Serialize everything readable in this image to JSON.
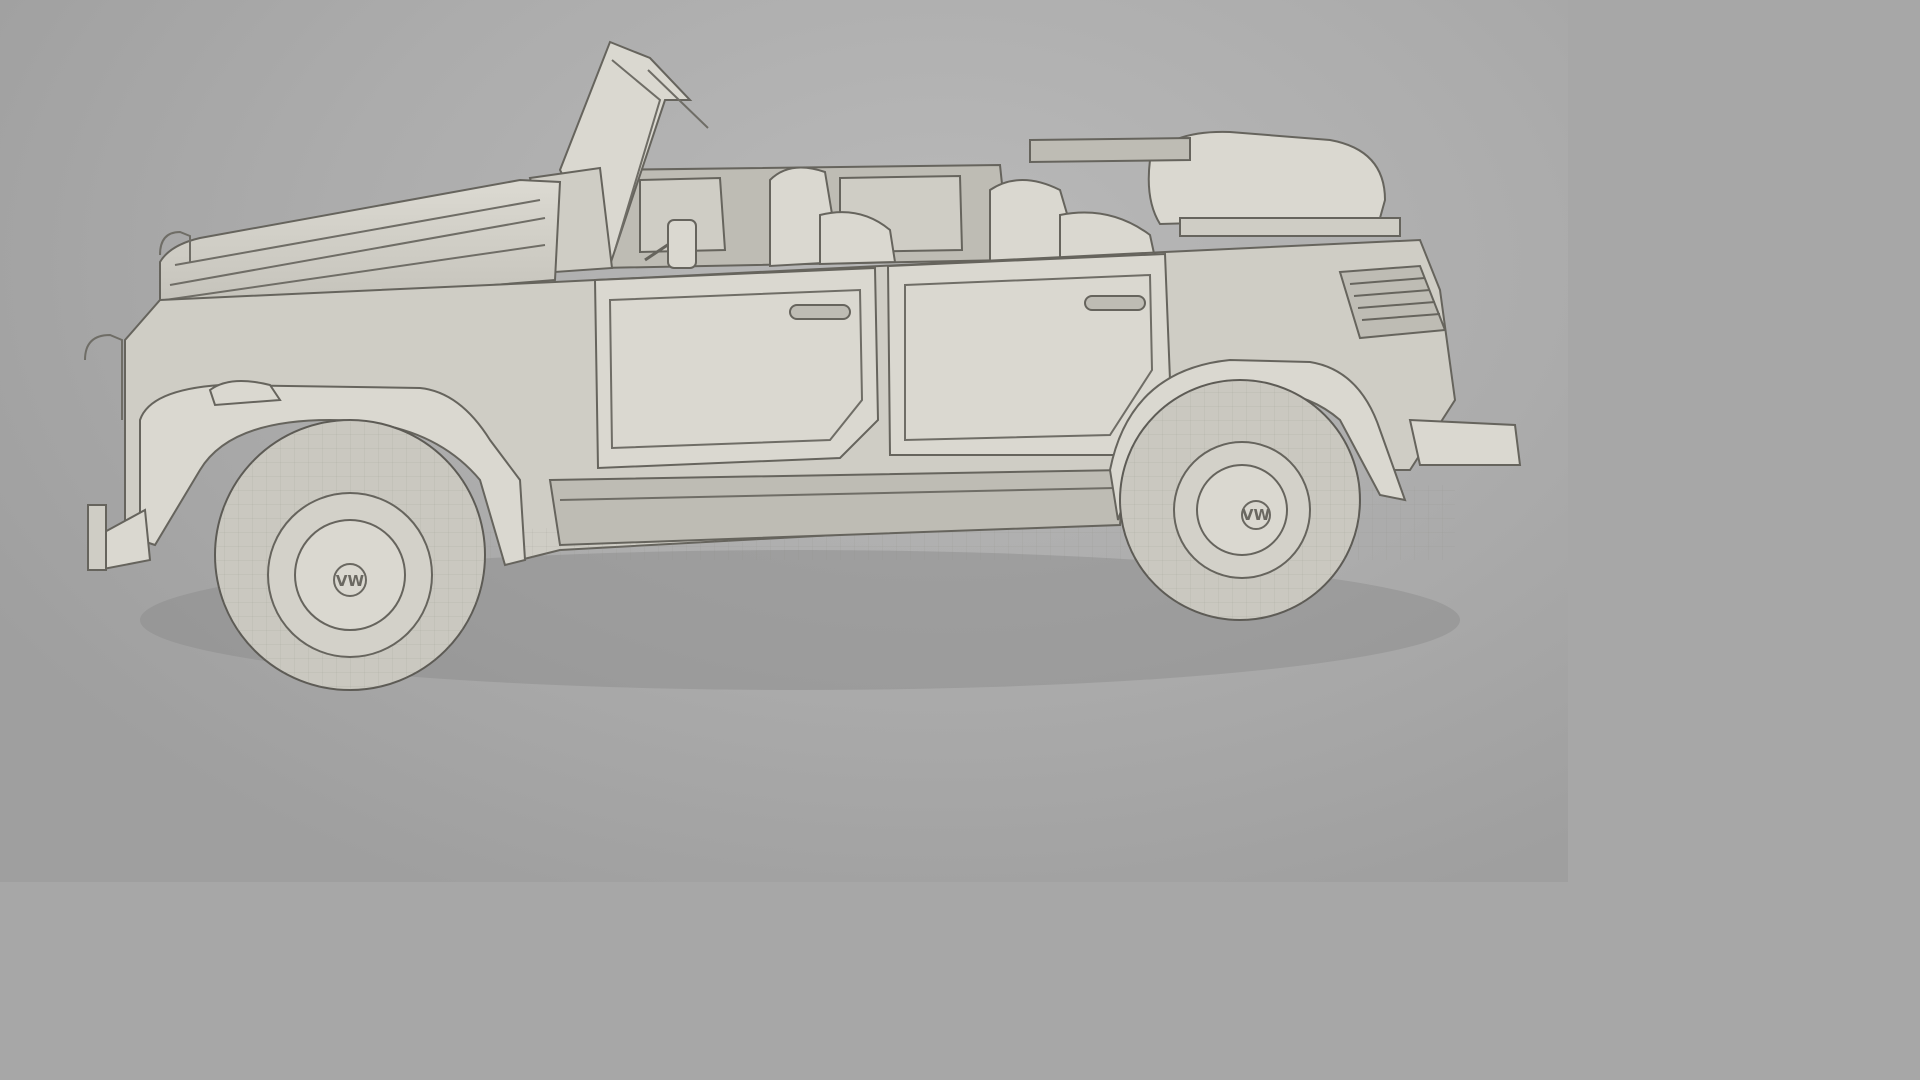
{
  "scene": {
    "subject": "vehicle-3d-wireframe-render",
    "background_color": "#acacac",
    "shadow_color": "#8a8a8a",
    "body_color": "#cfcdc5",
    "wire_color": "#8f8d84",
    "outline_color": "#66645d"
  },
  "vehicle": {
    "front_wheel_logo": "VW",
    "rear_wheel_logo": "VW"
  }
}
